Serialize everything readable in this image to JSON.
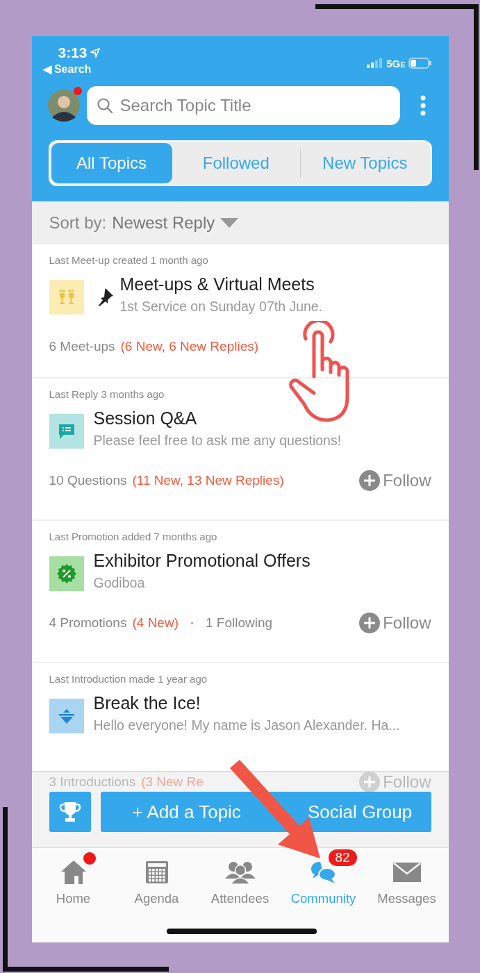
{
  "status_bar": {
    "time": "3:13",
    "back_label": "◀ Search",
    "network": "5G",
    "network_suffix": "E"
  },
  "header": {
    "avatar_notification": true,
    "search": {
      "placeholder": "Search Topic Title"
    }
  },
  "tabs": [
    {
      "label": "All Topics",
      "selected": true
    },
    {
      "label": "Followed",
      "selected": false
    },
    {
      "label": "New Topics",
      "selected": false
    }
  ],
  "sort": {
    "label": "Sort by:",
    "value": "Newest Reply"
  },
  "topics": [
    {
      "meta": "Last Meet-up created 1 month ago",
      "kind": "meetup",
      "pinned": true,
      "title": "Meet-ups & Virtual Meets",
      "subtitle": "1st Service on Sunday 07th June.",
      "count": "6 Meet-ups",
      "new_info": "(6 New, 6 New Replies)"
    },
    {
      "meta": "Last Reply 3 months ago",
      "kind": "qa",
      "pinned": false,
      "title": "Session Q&A",
      "subtitle": "Please feel free to ask me any questions!",
      "count": "10 Questions",
      "new_info": "(11 New, 13 New Replies)",
      "follow": "Follow"
    },
    {
      "meta": "Last Promotion added 7 months ago",
      "kind": "promo",
      "pinned": false,
      "title": "Exhibitor Promotional Offers",
      "subtitle": "Godiboa",
      "count": "4 Promotions",
      "new_info": "(4 New)",
      "following": "1 Following",
      "follow": "Follow"
    },
    {
      "meta": "Last Introduction made 1 year ago",
      "kind": "ice",
      "pinned": false,
      "title": "Break the Ice!",
      "subtitle": "Hello everyone! My name is Jason Alexander. Ha...",
      "count": "3 Introductions",
      "new_info": "(3 New Re",
      "follow": "Follow"
    }
  ],
  "add_button": {
    "label_start": "+ Add a Topic",
    "label_end": "Social Group"
  },
  "nav": [
    {
      "label": "Home",
      "selected": false,
      "dot": true
    },
    {
      "label": "Agenda",
      "selected": false,
      "dot": false
    },
    {
      "label": "Attendees",
      "selected": false,
      "dot": false
    },
    {
      "label": "Community",
      "selected": true,
      "dot": false,
      "badge": "82"
    },
    {
      "label": "Messages",
      "selected": false,
      "dot": false
    }
  ]
}
